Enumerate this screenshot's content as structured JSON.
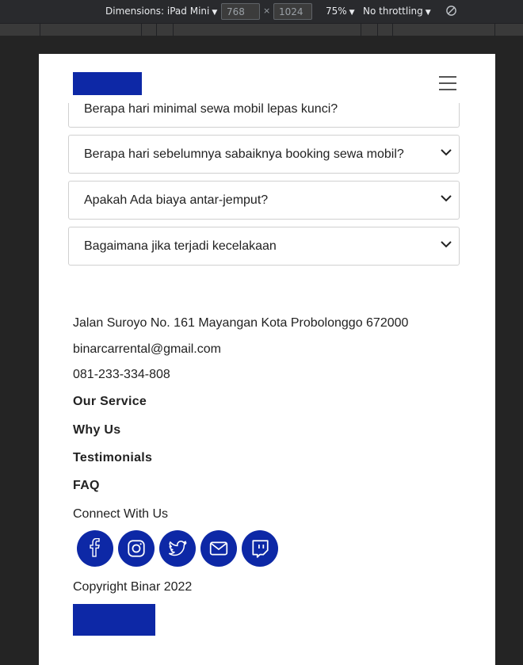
{
  "devtools": {
    "dimensions_label": "Dimensions: iPad Mini",
    "width_value": "768",
    "times": "×",
    "height_value": "1024",
    "zoom_label": "75%",
    "throttle_label": "No throttling",
    "icons": [
      "caret-down-icon",
      "rotate-icon"
    ]
  },
  "header": {
    "icons": [
      "menu-icon"
    ]
  },
  "faq": {
    "partial_question": "Berapa hari minimal sewa mobil lepas kunci?",
    "items": [
      {
        "question": "Berapa hari sebelumnya sabaiknya booking sewa mobil?"
      },
      {
        "question": "Apakah Ada biaya antar-jemput?"
      },
      {
        "question": "Bagaimana jika terjadi kecelakaan"
      }
    ]
  },
  "footer": {
    "address": "Jalan Suroyo No. 161 Mayangan Kota Probolonggo 672000",
    "email": "binarcarrental@gmail.com",
    "phone": "081-233-334-808",
    "links": [
      "Our Service",
      "Why Us",
      "Testimonials",
      "FAQ"
    ],
    "connect_label": "Connect With Us",
    "social_icons": [
      "facebook-icon",
      "instagram-icon",
      "twitter-icon",
      "mail-icon",
      "twitch-icon"
    ],
    "copyright": "Copyright Binar 2022"
  },
  "colors": {
    "brand": "#0D28A6",
    "background": "#FFFFFF",
    "devtools_bg": "#292A2D"
  }
}
